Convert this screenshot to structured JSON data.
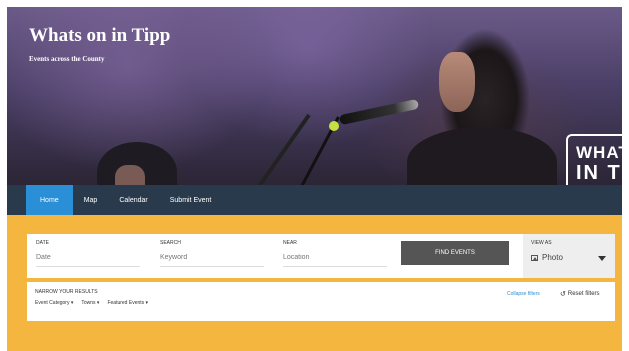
{
  "hero": {
    "title": "Whats on in Tipp",
    "subtitle": "Events across the County",
    "logo_line1": "WHATS",
    "logo_line2": "IN T"
  },
  "nav": {
    "items": [
      {
        "label": "Home",
        "active": true
      },
      {
        "label": "Map",
        "active": false
      },
      {
        "label": "Calendar",
        "active": false
      },
      {
        "label": "Submit Event",
        "active": false
      }
    ]
  },
  "search": {
    "date_label": "DATE",
    "date_placeholder": "Date",
    "search_label": "SEARCH",
    "search_placeholder": "Keyword",
    "near_label": "NEAR",
    "near_placeholder": "Location",
    "find_button": "FIND EVENTS",
    "view_as_label": "VIEW AS",
    "view_as_value": "Photo"
  },
  "filters": {
    "title": "NARROW YOUR RESULTS",
    "items": [
      "Event Category ▾",
      "Towns ▾",
      "Featured Events ▾"
    ],
    "collapse": "Collapse filters",
    "reset": "Reset filters"
  },
  "colors": {
    "nav_bg": "#283a4c",
    "nav_active": "#2a8fd6",
    "band": "#f4b63f"
  }
}
